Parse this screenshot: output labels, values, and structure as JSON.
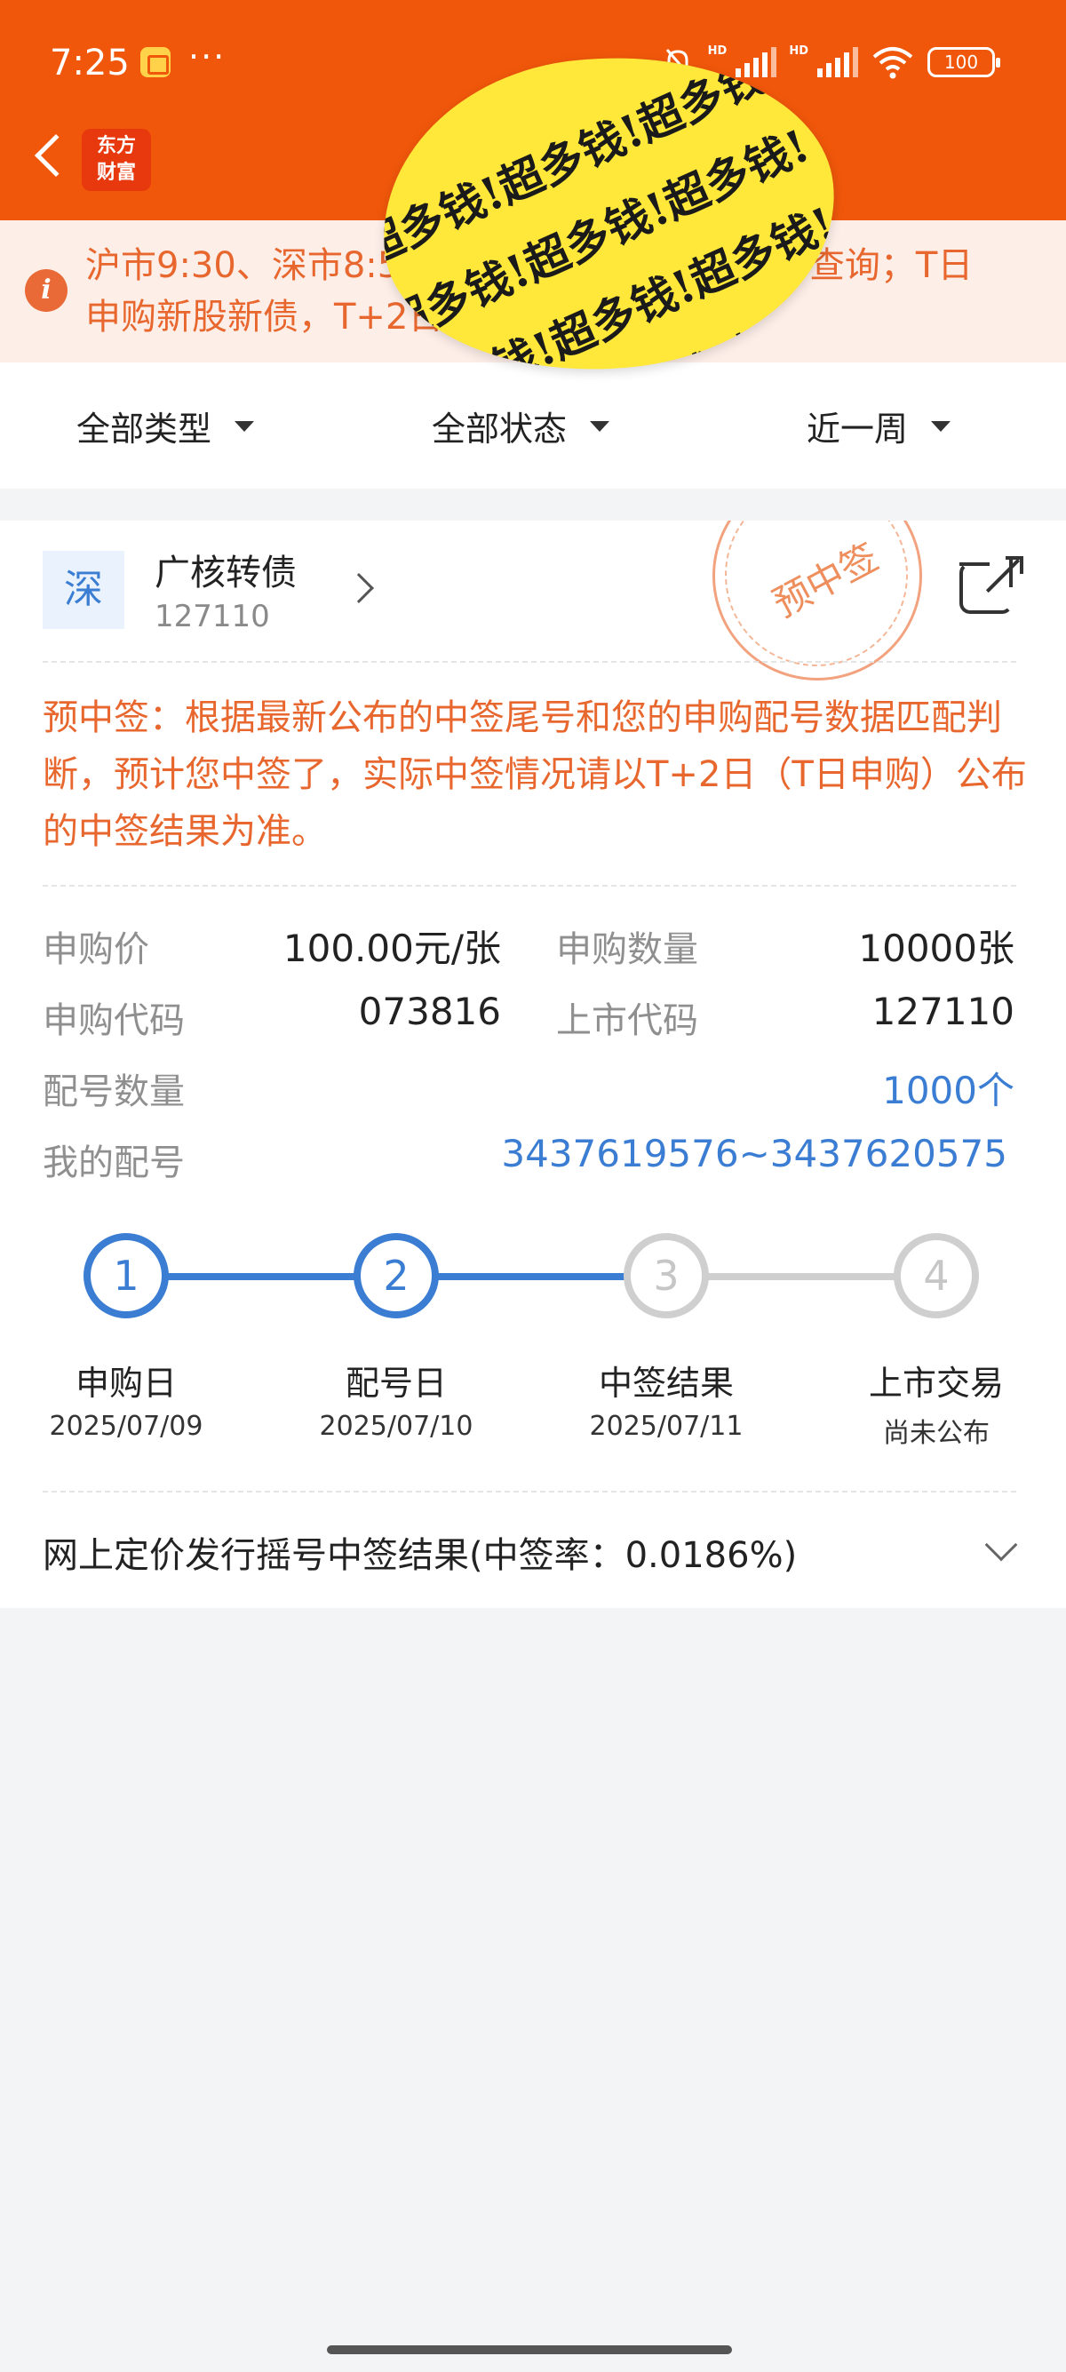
{
  "status_bar": {
    "time": "7:25",
    "dots": "···",
    "hd": "HD",
    "battery": "100"
  },
  "header": {
    "logo_line1": "东方",
    "logo_line2": "财富"
  },
  "sticker": {
    "text": "超多钱!超多钱!超多钱!"
  },
  "notice": {
    "text": "沪市9:30、深市8:50之前提示；10:00之后可查询；T日申购新股新债，T+2日查看中签结果。"
  },
  "filters": {
    "type": "全部类型",
    "status": "全部状态",
    "period": "近一周"
  },
  "bond": {
    "exchange": "深",
    "name": "广核转债",
    "code": "127110",
    "stamp": "预中签",
    "hint": "预中签：根据最新公布的中签尾号和您的申购配号数据匹配判断，预计您中签了，实际中签情况请以T+2日（T日申购）公布的中签结果为准。",
    "fields": {
      "price_label": "申购价",
      "price_value": "100.00元/张",
      "qty_label": "申购数量",
      "qty_value": "10000张",
      "sub_code_label": "申购代码",
      "sub_code_value": "073816",
      "list_code_label": "上市代码",
      "list_code_value": "127110",
      "alloc_count_label": "配号数量",
      "alloc_count_value": "1000个",
      "my_alloc_label": "我的配号",
      "my_alloc_value": "3437619576~3437620575"
    }
  },
  "steps": [
    {
      "num": "1",
      "name": "申购日",
      "date": "2025/07/09",
      "done": true
    },
    {
      "num": "2",
      "name": "配号日",
      "date": "2025/07/10",
      "done": true
    },
    {
      "num": "3",
      "name": "中签结果",
      "date": "2025/07/11",
      "done": false
    },
    {
      "num": "4",
      "name": "上市交易",
      "date": "尚未公布",
      "done": false
    }
  ],
  "result": {
    "title": "网上定价发行摇号中签结果(中签率：0.0186%)"
  },
  "colors": {
    "brand": "#f0570b",
    "accent": "#3a7dd3",
    "warning_text": "#e8672e"
  }
}
